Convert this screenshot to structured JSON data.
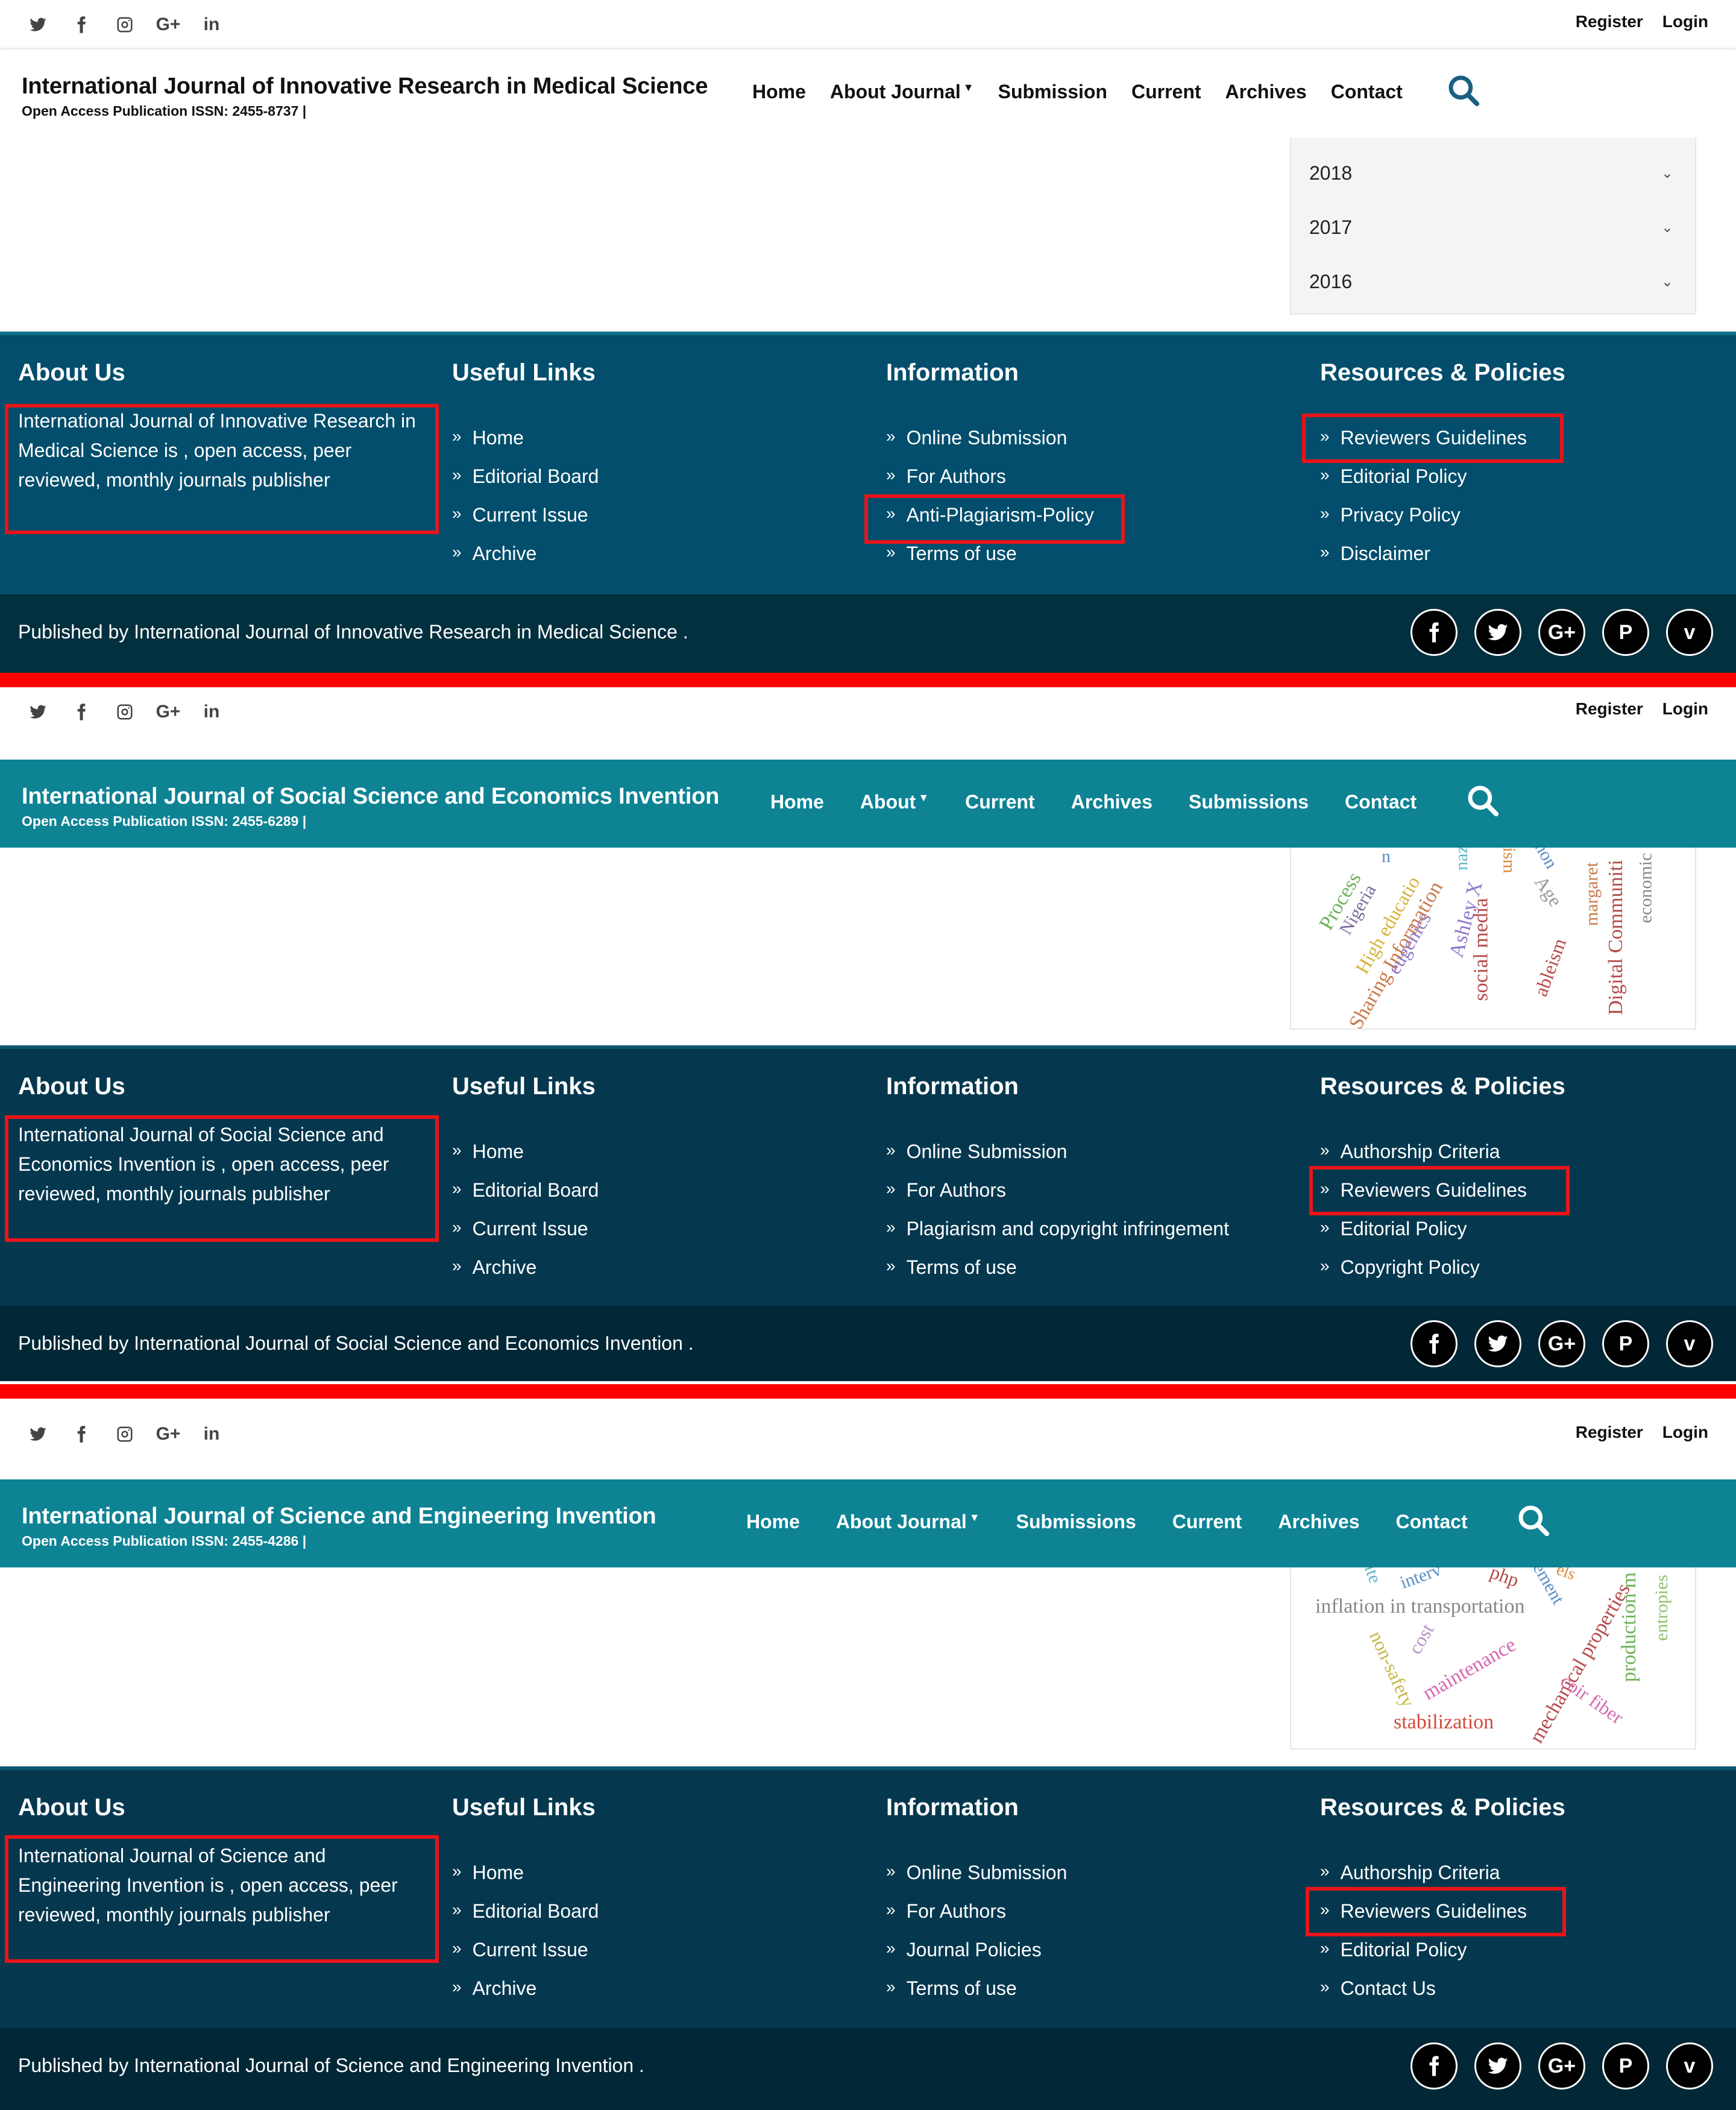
{
  "topbar": {
    "social_icons": [
      "twitter-icon",
      "facebook-icon",
      "instagram-icon",
      "google-plus-icon",
      "linkedin-icon"
    ],
    "register": "Register",
    "login": "Login"
  },
  "panel1": {
    "title": "International Journal of Innovative Research in Medical Science",
    "issn": "Open Access Publication ISSN: 2455-8737 |",
    "nav": [
      "Home",
      "About Journal",
      "Submission",
      "Current",
      "Archives",
      "Contact"
    ],
    "years": [
      "2018",
      "2017",
      "2016"
    ],
    "footer": {
      "about_heading": "About Us",
      "about_text": "International Journal of Innovative Research in Medical Science is , open access, peer reviewed, monthly journals publisher",
      "useful_heading": "Useful Links",
      "useful": [
        "Home",
        "Editorial Board",
        "Current Issue",
        "Archive"
      ],
      "info_heading": "Information",
      "info": [
        "Online Submission",
        "For Authors",
        "Anti-Plagiarism-Policy",
        "Terms of use"
      ],
      "res_heading": "Resources & Policies",
      "res": [
        "Reviewers Guidelines",
        "Editorial Policy",
        "Privacy Policy",
        "Disclaimer"
      ]
    },
    "published": "Published by International Journal of Innovative Research in Medical Science ."
  },
  "panel2": {
    "title": "International Journal of Social Science and Economics Invention",
    "issn": "Open Access Publication ISSN: 2455-6289 |",
    "nav": [
      "Home",
      "About",
      "Current",
      "Archives",
      "Submissions",
      "Contact"
    ],
    "cloud_words": [
      "Process",
      "Nigeria",
      "High educatio",
      "Sharing Information",
      "eugenics",
      "Ashley X",
      "nazi",
      "social media",
      "ism",
      "Age",
      "ableism",
      "margaret",
      "Digital Communiti",
      "economic",
      "n",
      "non"
    ],
    "footer": {
      "about_heading": "About Us",
      "about_text": "International Journal of Social Science and Economics Invention is , open access, peer reviewed, monthly journals publisher",
      "useful_heading": "Useful Links",
      "useful": [
        "Home",
        "Editorial Board",
        "Current Issue",
        "Archive"
      ],
      "info_heading": "Information",
      "info": [
        "Online Submission",
        "For Authors",
        "Plagiarism and copyright infringement",
        "Terms of use"
      ],
      "res_heading": "Resources & Policies",
      "res": [
        "Authorship Criteria",
        "Reviewers Guidelines",
        "Editorial Policy",
        "Copyright Policy"
      ]
    },
    "published": "Published by International Journal of Social Science and Economics Invention ."
  },
  "panel3": {
    "title": "International Journal of Science and Engineering Invention",
    "issn": "Open Access Publication ISSN: 2455-4286 |",
    "nav": [
      "Home",
      "About Journal",
      "Submissions",
      "Current",
      "Archives",
      "Contact"
    ],
    "cloud_words": [
      "inflation in transportation",
      "non-safety",
      "cost",
      "maintenance",
      "mechanical properties",
      "coir fiber",
      "production m",
      "entropies",
      "stabilization",
      "php",
      "ement",
      "ite",
      "interv",
      "els"
    ],
    "footer": {
      "about_heading": "About Us",
      "about_text": "International Journal of Science and Engineering Invention is , open access, peer reviewed, monthly journals publisher",
      "useful_heading": "Useful Links",
      "useful": [
        "Home",
        "Editorial Board",
        "Current Issue",
        "Archive"
      ],
      "info_heading": "Information",
      "info": [
        "Online Submission",
        "For Authors",
        "Journal Policies",
        "Terms of use"
      ],
      "res_heading": "Resources & Policies",
      "res": [
        "Authorship Criteria",
        "Reviewers Guidelines",
        "Editorial Policy",
        "Contact Us"
      ]
    },
    "published": "Published by International Journal of Science and Engineering Invention ."
  },
  "bottom_icons": [
    "facebook-icon",
    "twitter-icon",
    "google-plus-icon",
    "pinterest-icon",
    "vimeo-icon"
  ],
  "colors": {
    "highlight": "#e8141a",
    "separator": "#ff0000",
    "teal_header": "#0d8394",
    "footer_blue": "#024e6c",
    "footer_dark": "#05384f",
    "bottom_bar": "#03303f"
  }
}
